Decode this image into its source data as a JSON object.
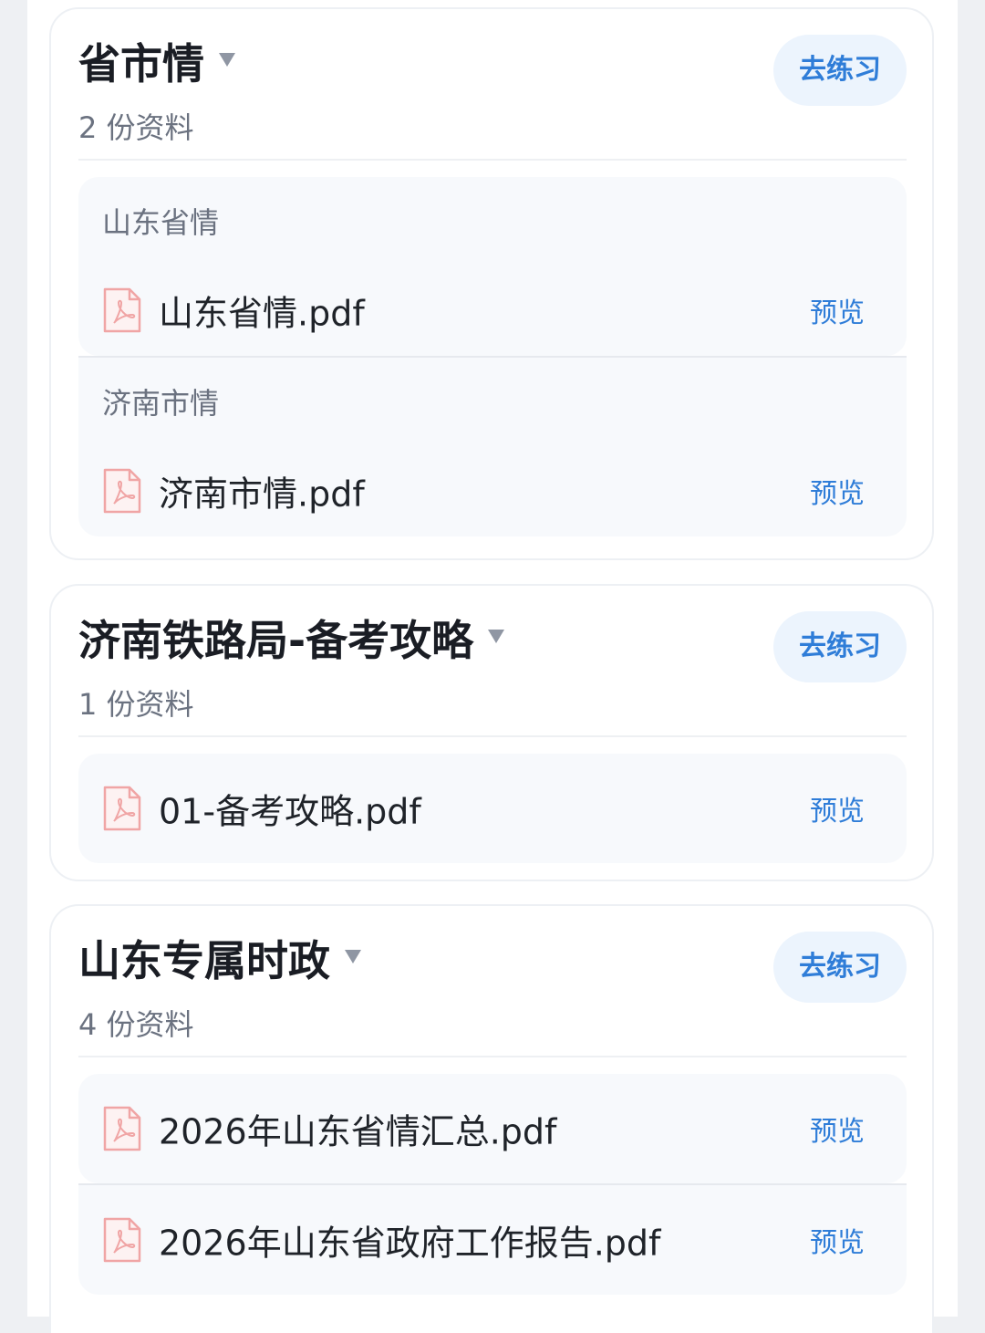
{
  "sections": [
    {
      "title": "省市情",
      "count_label": "2 份资料",
      "practice_label": "去练习",
      "groups": [
        {
          "label": "山东省情",
          "files": [
            {
              "name": "山东省情.pdf",
              "preview_label": "预览"
            }
          ]
        },
        {
          "label": "济南市情",
          "files": [
            {
              "name": "济南市情.pdf",
              "preview_label": "预览"
            }
          ]
        }
      ]
    },
    {
      "title": "济南铁路局-备考攻略",
      "count_label": "1 份资料",
      "practice_label": "去练习",
      "groups": [
        {
          "label": "",
          "files": [
            {
              "name": "01-备考攻略.pdf",
              "preview_label": "预览"
            }
          ]
        }
      ]
    },
    {
      "title": "山东专属时政",
      "count_label": "4 份资料",
      "practice_label": "去练习",
      "groups": [
        {
          "label": "",
          "files": [
            {
              "name": "2026年山东省情汇总.pdf",
              "preview_label": "预览"
            }
          ]
        },
        {
          "label": "",
          "files": [
            {
              "name": "2026年山东省政府工作报告.pdf",
              "preview_label": "预览"
            }
          ]
        }
      ]
    }
  ],
  "icons": {
    "file": "pdf-file-icon",
    "toggle": "caret-down-icon"
  },
  "colors": {
    "accent": "#2f7dd8",
    "pdf": "#f0a5a5",
    "button_bg": "#ecf4fd"
  }
}
